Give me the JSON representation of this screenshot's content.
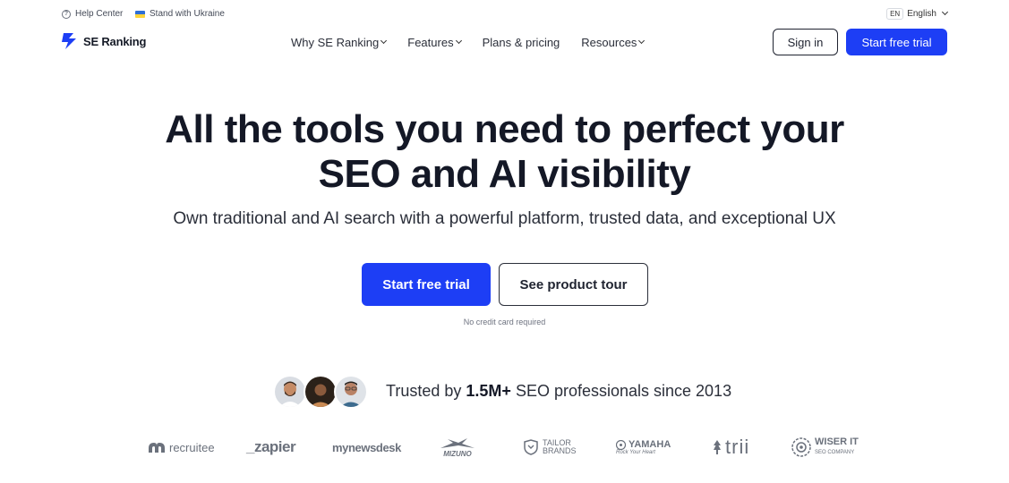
{
  "utility": {
    "help_center": "Help Center",
    "stand_with_ukraine": "Stand with Ukraine",
    "lang_code": "EN",
    "lang_name": "English"
  },
  "nav": {
    "brand": "SE Ranking",
    "items": [
      {
        "label": "Why SE Ranking",
        "has_dropdown": true
      },
      {
        "label": "Features",
        "has_dropdown": true
      },
      {
        "label": "Plans & pricing",
        "has_dropdown": false
      },
      {
        "label": "Resources",
        "has_dropdown": true
      }
    ],
    "sign_in": "Sign in",
    "start_trial": "Start free trial"
  },
  "hero": {
    "title_line1": "All the tools you need to perfect your",
    "title_line2": "SEO and AI visibility",
    "subtitle": "Own traditional and AI search with a powerful platform, trusted data, and exceptional UX",
    "cta_primary": "Start free trial",
    "cta_secondary": "See product tour",
    "note": "No credit card required"
  },
  "trust": {
    "prefix": "Trusted by",
    "count": "1.5M+",
    "suffix": "SEO professionals since 2013"
  },
  "logos": {
    "recruitee": "recruitee",
    "zapier": "_zapier",
    "newsdesk": "mynewsdesk",
    "mizuno": "MIZUNO",
    "tailor_line1": "TAILOR",
    "tailor_line2": "BRANDS",
    "yamaha": "YAMAHA",
    "yamaha_tagline": "Rock Your Heart",
    "trii": "trii",
    "wiser_line1": "WISER IT",
    "wiser_line2": "SEO COMPANY"
  },
  "colors": {
    "brand_blue": "#1d3ef5",
    "text_dark": "#141826",
    "logo_gray": "#6b717c"
  }
}
